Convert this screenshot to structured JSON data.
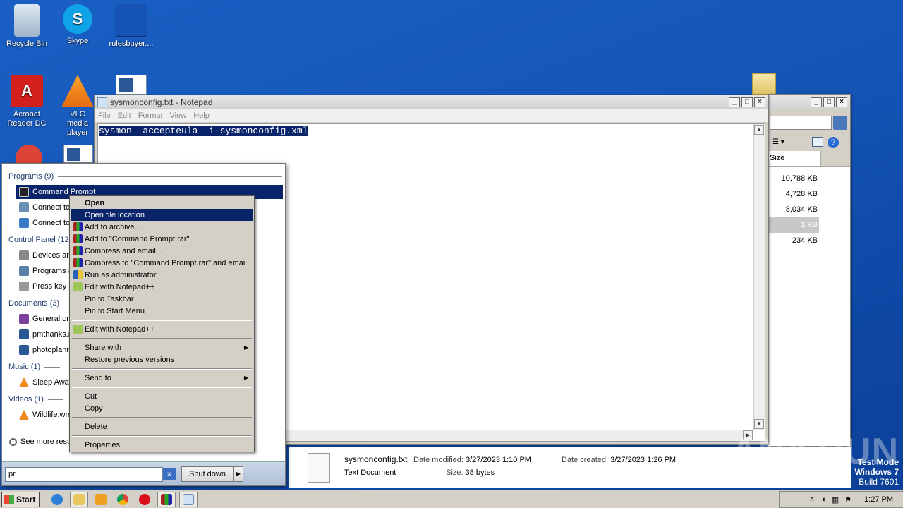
{
  "desktop": {
    "icons": [
      {
        "label": "Recycle Bin"
      },
      {
        "label": "Skype"
      },
      {
        "label": "rulesbuyer...."
      },
      {
        "label": "Acrobat Reader DC"
      },
      {
        "label": "VLC media player"
      }
    ]
  },
  "notepad": {
    "title": "sysmonconfig.txt - Notepad",
    "menu": [
      "File",
      "Edit",
      "Format",
      "View",
      "Help"
    ],
    "content": "sysmon -accepteula -i sysmonconfig.xml"
  },
  "explorer": {
    "column_header": "Size",
    "sizes": [
      "10,788 KB",
      "4,728 KB",
      "8,034 KB",
      "1 KB",
      "234 KB"
    ],
    "details": {
      "file_name": "sysmonconfig.txt",
      "file_type": "Text Document",
      "date_modified_label": "Date modified:",
      "date_modified": "3/27/2023 1:10 PM",
      "size_label": "Size:",
      "size": "38 bytes",
      "date_created_label": "Date created:",
      "date_created": "3/27/2023 1:26 PM"
    }
  },
  "start_menu": {
    "programs_header": "Programs (9)",
    "programs": [
      "Command Prompt",
      "Connect to",
      "Connect to"
    ],
    "control_panel_header": "Control Panel (128",
    "control_panel": [
      "Devices and",
      "Programs a",
      "Press key c"
    ],
    "documents_header": "Documents (3)",
    "documents": [
      "General.on",
      "pmthanks.r",
      "photoplann"
    ],
    "music_header": "Music (1)",
    "music": [
      "Sleep Away"
    ],
    "videos_header": "Videos (1)",
    "videos": [
      "Wildlife.wm"
    ],
    "see_more": "See more resu",
    "search_value": "pr",
    "shutdown_label": "Shut down"
  },
  "context_menu": {
    "items": [
      {
        "label": "Open",
        "bold": true
      },
      {
        "label": "Open file location"
      },
      {
        "label": "Add to archive..."
      },
      {
        "label": "Add to \"Command Prompt.rar\""
      },
      {
        "label": "Compress and email..."
      },
      {
        "label": "Compress to \"Command Prompt.rar\" and email"
      },
      {
        "label": "Run as administrator"
      },
      {
        "label": "Edit with Notepad++"
      },
      {
        "label": "Pin to Taskbar"
      },
      {
        "label": "Pin to Start Menu"
      },
      {
        "label": "Edit with Notepad++"
      },
      {
        "label": "Share with"
      },
      {
        "label": "Restore previous versions"
      },
      {
        "label": "Send to"
      },
      {
        "label": "Cut"
      },
      {
        "label": "Copy"
      },
      {
        "label": "Delete"
      },
      {
        "label": "Properties"
      }
    ]
  },
  "taskbar": {
    "start_label": "Start",
    "clock": "1:27 PM"
  },
  "watermark": {
    "test_mode": "Test Mode",
    "os": "Windows 7",
    "build": "Build 7601",
    "brand": "ANY.RUN"
  }
}
